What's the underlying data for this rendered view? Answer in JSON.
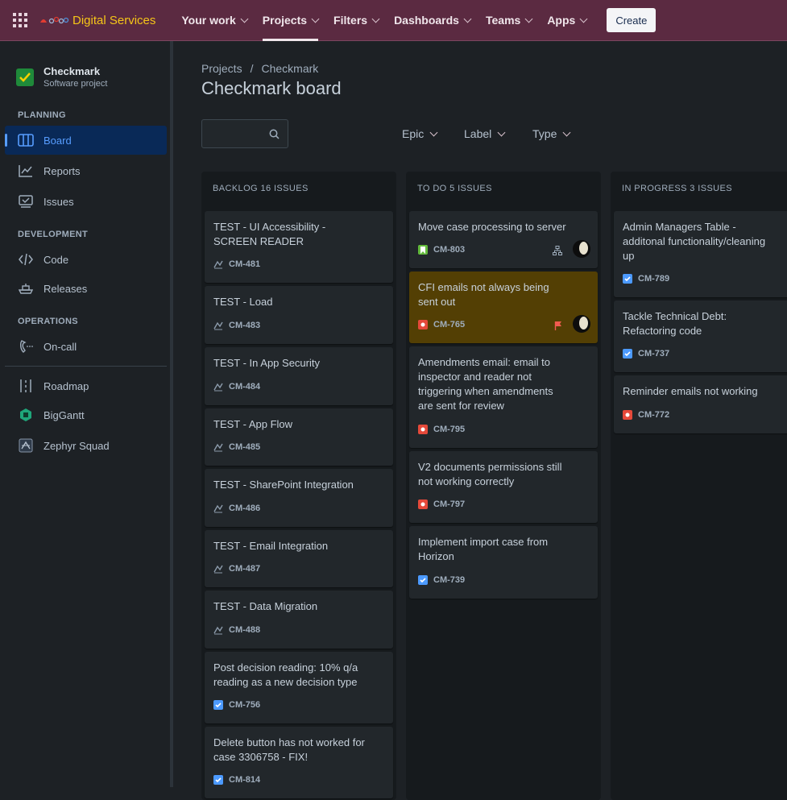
{
  "topbar": {
    "brand": "Digital Services",
    "nav": [
      {
        "label": "Your work"
      },
      {
        "label": "Projects"
      },
      {
        "label": "Filters"
      },
      {
        "label": "Dashboards"
      },
      {
        "label": "Teams"
      },
      {
        "label": "Apps"
      }
    ],
    "create_label": "Create"
  },
  "sidebar": {
    "project_name": "Checkmark",
    "project_type": "Software project",
    "planning": "PLANNING",
    "board": "Board",
    "reports": "Reports",
    "issues": "Issues",
    "development": "DEVELOPMENT",
    "code": "Code",
    "releases": "Releases",
    "operations": "OPERATIONS",
    "oncall": "On-call",
    "roadmap": "Roadmap",
    "biggantt": "BigGantt",
    "zephyr": "Zephyr Squad"
  },
  "main": {
    "crumb_projects": "Projects",
    "crumb_sep": "/",
    "crumb_project": "Checkmark",
    "title": "Checkmark board",
    "filters": {
      "epic": "Epic",
      "label": "Label",
      "type": "Type"
    }
  },
  "columns": [
    {
      "name": "BACKLOG",
      "count": "16 ISSUES",
      "cards": [
        {
          "title": "TEST - UI Accessibility - SCREEN READER",
          "key": "CM-481",
          "type": "test"
        },
        {
          "title": "TEST - Load",
          "key": "CM-483",
          "type": "test"
        },
        {
          "title": "TEST - In App Security",
          "key": "CM-484",
          "type": "test"
        },
        {
          "title": "TEST - App Flow",
          "key": "CM-485",
          "type": "test"
        },
        {
          "title": "TEST - SharePoint Integration",
          "key": "CM-486",
          "type": "test"
        },
        {
          "title": "TEST - Email Integration",
          "key": "CM-487",
          "type": "test"
        },
        {
          "title": "TEST - Data Migration",
          "key": "CM-488",
          "type": "test"
        },
        {
          "title": "Post decision reading: 10% q/a reading as a new decision type",
          "key": "CM-756",
          "type": "task"
        },
        {
          "title": "Delete button has not worked for case 3306758 - FIX!",
          "key": "CM-814",
          "type": "task"
        }
      ]
    },
    {
      "name": "TO DO",
      "count": "5 ISSUES",
      "cards": [
        {
          "title": "Move case processing to server",
          "key": "CM-803",
          "type": "story"
        },
        {
          "title": "CFI emails not always being sent out",
          "key": "CM-765",
          "type": "bug"
        },
        {
          "title": "Amendments email: email to inspector and reader not triggering when amendments are sent for review",
          "key": "CM-795",
          "type": "bug"
        },
        {
          "title": "V2 documents permissions still not working correctly",
          "key": "CM-797",
          "type": "bug"
        },
        {
          "title": "Implement import case from Horizon",
          "key": "CM-739",
          "type": "task"
        }
      ]
    },
    {
      "name": "IN PROGRESS",
      "count": "3 ISSUES",
      "cards": [
        {
          "title": "Admin Managers Table - additonal functionality/cleaning up",
          "key": "CM-789",
          "type": "task"
        },
        {
          "title": "Tackle Technical Debt: Refactoring code",
          "key": "CM-737",
          "type": "task"
        },
        {
          "title": "Reminder emails not working",
          "key": "CM-772",
          "type": "bug"
        }
      ]
    }
  ]
}
